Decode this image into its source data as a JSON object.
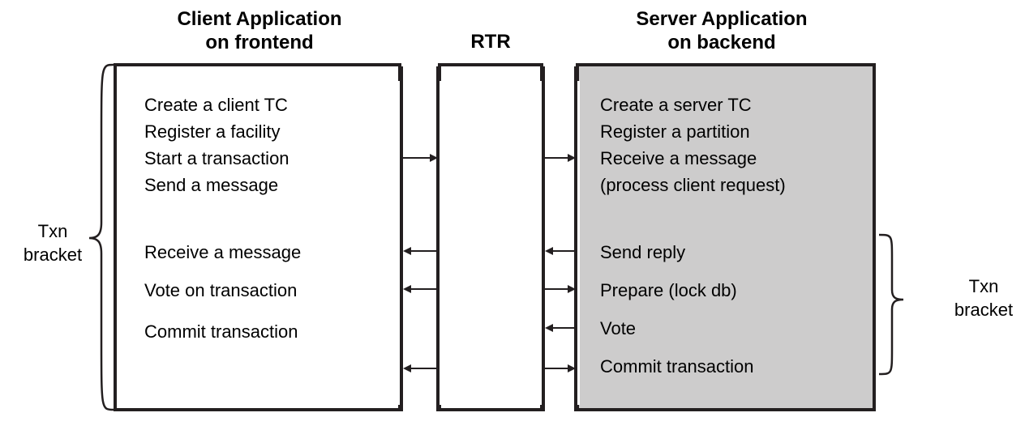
{
  "titles": {
    "client": "Client Application\non frontend",
    "rtr": "RTR",
    "server": "Server Application\non backend"
  },
  "client_steps": {
    "a": "Create a client TC",
    "b": "Register a facility",
    "c": "Start a transaction",
    "d": "Send a message",
    "e": "Receive a message",
    "f": "Vote on transaction",
    "g": "Commit transaction"
  },
  "server_steps": {
    "a": "Create a server TC",
    "b": "Register a partition",
    "c": "Receive a message",
    "d": "(process client request)",
    "e": "Send reply",
    "f": "Prepare (lock db)",
    "g": "Vote",
    "h": "Commit transaction"
  },
  "labels": {
    "txn_left_1": "Txn",
    "txn_left_2": "bracket",
    "txn_right_1": "Txn",
    "txn_right_2": "bracket"
  }
}
